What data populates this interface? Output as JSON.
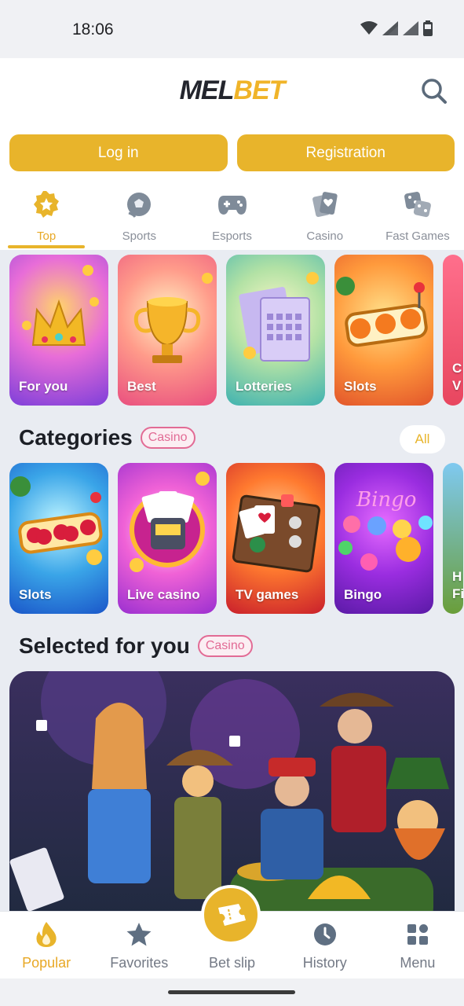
{
  "status_bar": {
    "time": "18:06"
  },
  "header": {
    "logo_part1": "MEL",
    "logo_part2": "BET",
    "login_label": "Log in",
    "registration_label": "Registration"
  },
  "tabs": [
    {
      "label": "Top",
      "icon": "star-badge-icon",
      "active": true
    },
    {
      "label": "Sports",
      "icon": "soccer-ball-icon"
    },
    {
      "label": "Esports",
      "icon": "gamepad-icon"
    },
    {
      "label": "Casino",
      "icon": "playing-cards-icon"
    },
    {
      "label": "Fast Games",
      "icon": "dice-icon"
    }
  ],
  "top_cards": [
    {
      "label": "For you"
    },
    {
      "label": "Best"
    },
    {
      "label": "Lotteries"
    },
    {
      "label": "Slots"
    },
    {
      "label": "C\nV"
    }
  ],
  "categories": {
    "title": "Categories",
    "badge": "Casino",
    "all_label": "All",
    "cards": [
      {
        "label": "Slots"
      },
      {
        "label": "Live casino"
      },
      {
        "label": "TV games"
      },
      {
        "label": "Bingo"
      },
      {
        "label": "H\nFi"
      }
    ]
  },
  "selected": {
    "title": "Selected for you",
    "badge": "Casino"
  },
  "bottom_nav": [
    {
      "label": "Popular",
      "icon": "flame-icon",
      "active": true
    },
    {
      "label": "Favorites",
      "icon": "star-icon"
    },
    {
      "label": "Bet slip",
      "icon": "ticket-icon"
    },
    {
      "label": "History",
      "icon": "clock-icon"
    },
    {
      "label": "Menu",
      "icon": "grid-icon"
    }
  ],
  "colors": {
    "accent": "#e8b42b",
    "badge": "#e26b95",
    "background": "#e9ecf2"
  }
}
